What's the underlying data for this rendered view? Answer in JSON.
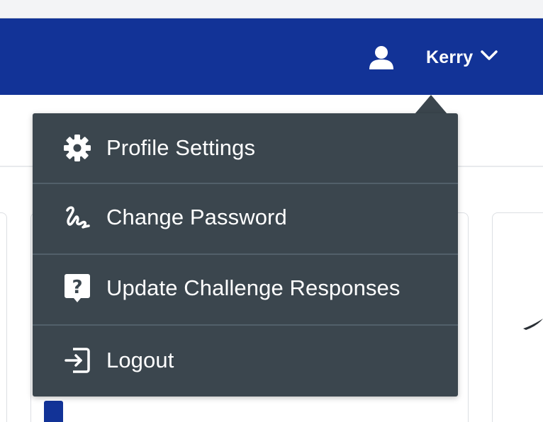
{
  "header": {
    "user_name": "Kerry",
    "user_icon": "user-icon",
    "chevron_icon": "chevron-down-icon",
    "background": "#123397"
  },
  "dropdown": {
    "background": "#3b464e",
    "items": [
      {
        "label": "Profile Settings",
        "icon": "gear-icon"
      },
      {
        "label": "Change Password",
        "icon": "signature-icon"
      },
      {
        "label": "Update Challenge Responses",
        "icon": "question-bubble-icon"
      },
      {
        "label": "Logout",
        "icon": "logout-icon"
      }
    ]
  }
}
